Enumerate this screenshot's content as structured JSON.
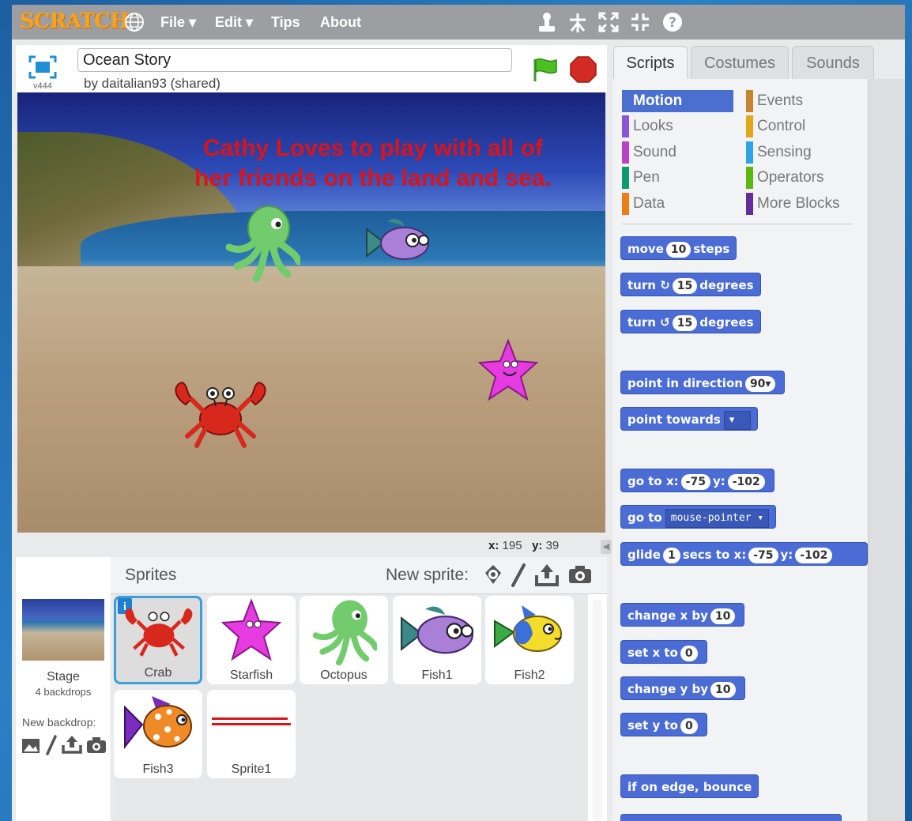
{
  "menubar": {
    "logo": "SCRATCH",
    "items": [
      "File ▾",
      "Edit ▾",
      "Tips",
      "About"
    ]
  },
  "project": {
    "title": "Ocean Story",
    "byline": "by daitalian93 (shared)",
    "version": "v444"
  },
  "stage": {
    "caption_line1": "Cathy Loves to play with all of",
    "caption_line2": "her friends on the land and sea."
  },
  "coords": {
    "x_label": "x:",
    "x_value": "195",
    "y_label": "y:",
    "y_value": "39"
  },
  "sprites_panel": {
    "title": "Sprites",
    "new_sprite_label": "New sprite:",
    "stage_label": "Stage",
    "backdrops": "4 backdrops",
    "new_backdrop_label": "New backdrop:",
    "sprites": [
      "Crab",
      "Starfish",
      "Octopus",
      "Fish1",
      "Fish2",
      "Fish3",
      "Sprite1"
    ],
    "selected": "Crab",
    "info_badge": "i"
  },
  "tabs": [
    "Scripts",
    "Costumes",
    "Sounds"
  ],
  "categories": [
    {
      "label": "Motion",
      "color": "#4a6cd4"
    },
    {
      "label": "Events",
      "color": "#c88330"
    },
    {
      "label": "Looks",
      "color": "#8a55d7"
    },
    {
      "label": "Control",
      "color": "#e1a91a"
    },
    {
      "label": "Sound",
      "color": "#bb42c3"
    },
    {
      "label": "Sensing",
      "color": "#2ca5e2"
    },
    {
      "label": "Pen",
      "color": "#0e9a6c"
    },
    {
      "label": "Operators",
      "color": "#5cb712"
    },
    {
      "label": "Data",
      "color": "#ee7d16"
    },
    {
      "label": "More Blocks",
      "color": "#632d99"
    }
  ],
  "blocks": {
    "move": {
      "pre": "move",
      "val": "10",
      "post": "steps"
    },
    "turn_cw": {
      "pre": "turn",
      "icon": "↻",
      "val": "15",
      "post": "degrees"
    },
    "turn_ccw": {
      "pre": "turn",
      "icon": "↺",
      "val": "15",
      "post": "degrees"
    },
    "point_dir": {
      "pre": "point in direction",
      "val": "90▾"
    },
    "point_towards": {
      "pre": "point towards",
      "drop": "▾"
    },
    "goto_xy": {
      "pre": "go to x:",
      "x": "-75",
      "mid": "y:",
      "y": "-102"
    },
    "goto": {
      "pre": "go to",
      "drop": "mouse-pointer ▾"
    },
    "glide": {
      "pre": "glide",
      "val": "1",
      "mid": "secs to x:",
      "x": "-75",
      "mid2": "y:",
      "y": "-102"
    },
    "change_x": {
      "pre": "change x by",
      "val": "10"
    },
    "set_x": {
      "pre": "set x to",
      "val": "0"
    },
    "change_y": {
      "pre": "change y by",
      "val": "10"
    },
    "set_y": {
      "pre": "set y to",
      "val": "0"
    },
    "bounce": {
      "pre": "if on edge, bounce"
    }
  },
  "colors": {
    "accent": "#4a6cd4",
    "menubar": "#9c9ea1",
    "selected_border": "#3c9fd6",
    "caption": "#d8141c"
  }
}
